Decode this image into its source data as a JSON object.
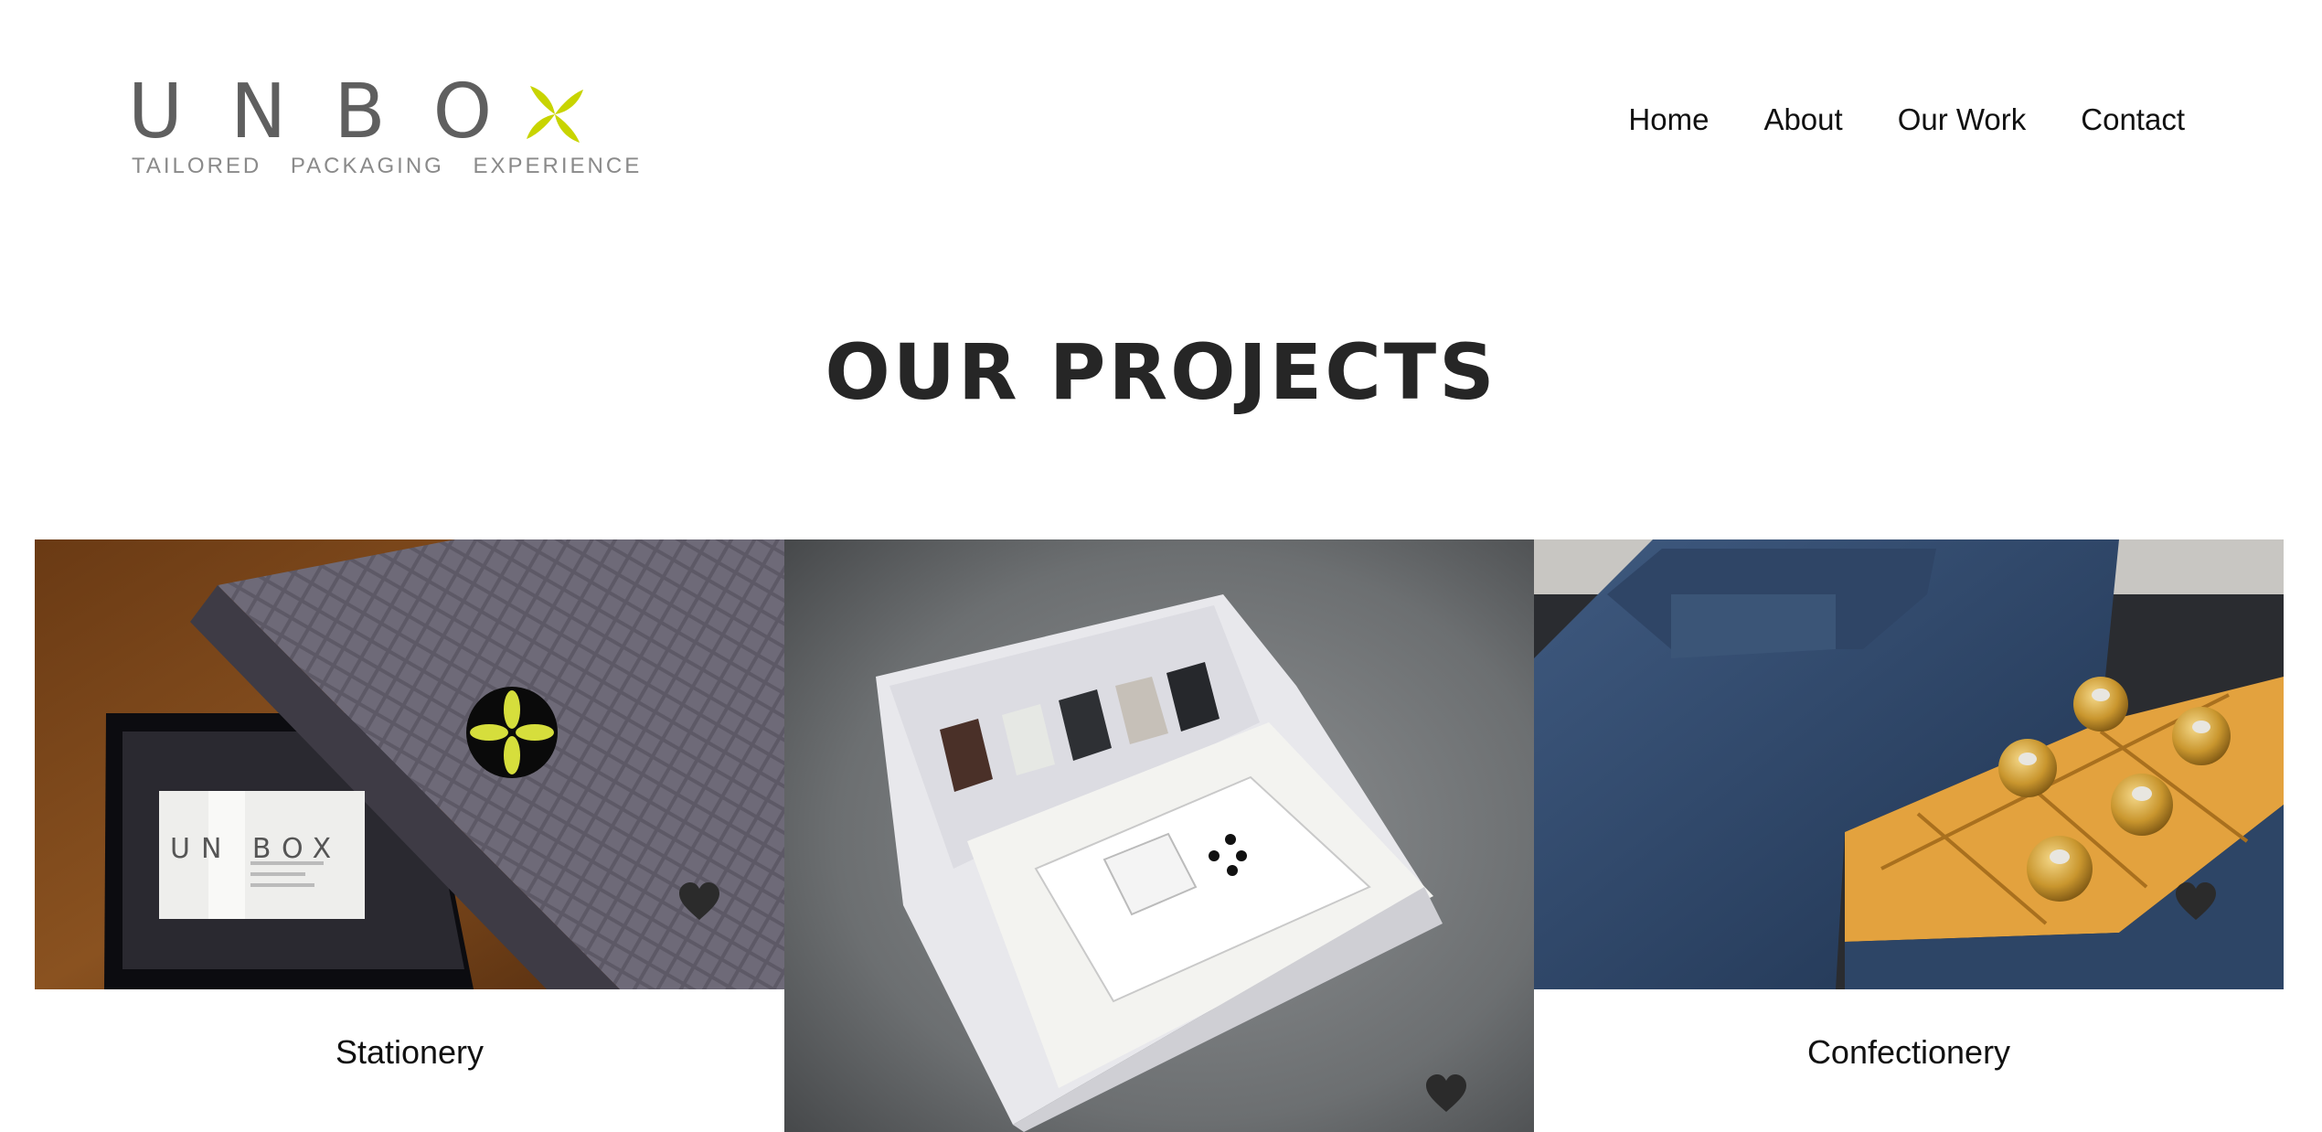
{
  "brand": {
    "letters": [
      "U",
      "N",
      "B",
      "O"
    ],
    "tagline": [
      "TAILORED",
      "PACKAGING",
      "EXPERIENCE"
    ],
    "accent_color": "#c8d400",
    "text_color": "#5f5f5f"
  },
  "nav": {
    "items": [
      {
        "label": "Home"
      },
      {
        "label": "About"
      },
      {
        "label": "Our Work"
      },
      {
        "label": "Contact"
      }
    ]
  },
  "main": {
    "title": "OUR PROJECTS",
    "projects": [
      {
        "caption": "Stationery",
        "icon": "heart-icon"
      },
      {
        "caption": "",
        "icon": "heart-icon"
      },
      {
        "caption": "Confectionery",
        "icon": "heart-icon"
      }
    ]
  }
}
